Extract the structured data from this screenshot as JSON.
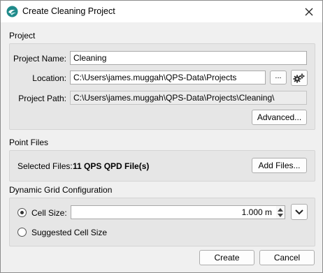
{
  "window": {
    "title": "Create Cleaning Project",
    "app_icon": "qps-app-icon",
    "close_icon": "close-icon"
  },
  "project": {
    "section_title": "Project",
    "name_label": "Project Name:",
    "name_value": "Cleaning",
    "location_label": "Location:",
    "location_value": "C:\\Users\\james.muggah\\QPS-Data\\Projects",
    "browse_label": "...",
    "settings_icon": "gears-icon",
    "path_label": "Project Path:",
    "path_value": "C:\\Users\\james.muggah\\QPS-Data\\Projects\\Cleaning\\",
    "advanced_label": "Advanced..."
  },
  "point_files": {
    "section_title": "Point Files",
    "selected_label": "Selected Files:",
    "selected_value": "11 QPS QPD File(s)",
    "add_label": "Add Files..."
  },
  "grid": {
    "section_title": "Dynamic Grid Configuration",
    "cell_size_label": "Cell Size:",
    "cell_size_value": "1.000 m",
    "cell_size_selected": true,
    "suggested_label": "Suggested Cell Size",
    "suggested_selected": false
  },
  "footer": {
    "create_label": "Create",
    "cancel_label": "Cancel"
  }
}
